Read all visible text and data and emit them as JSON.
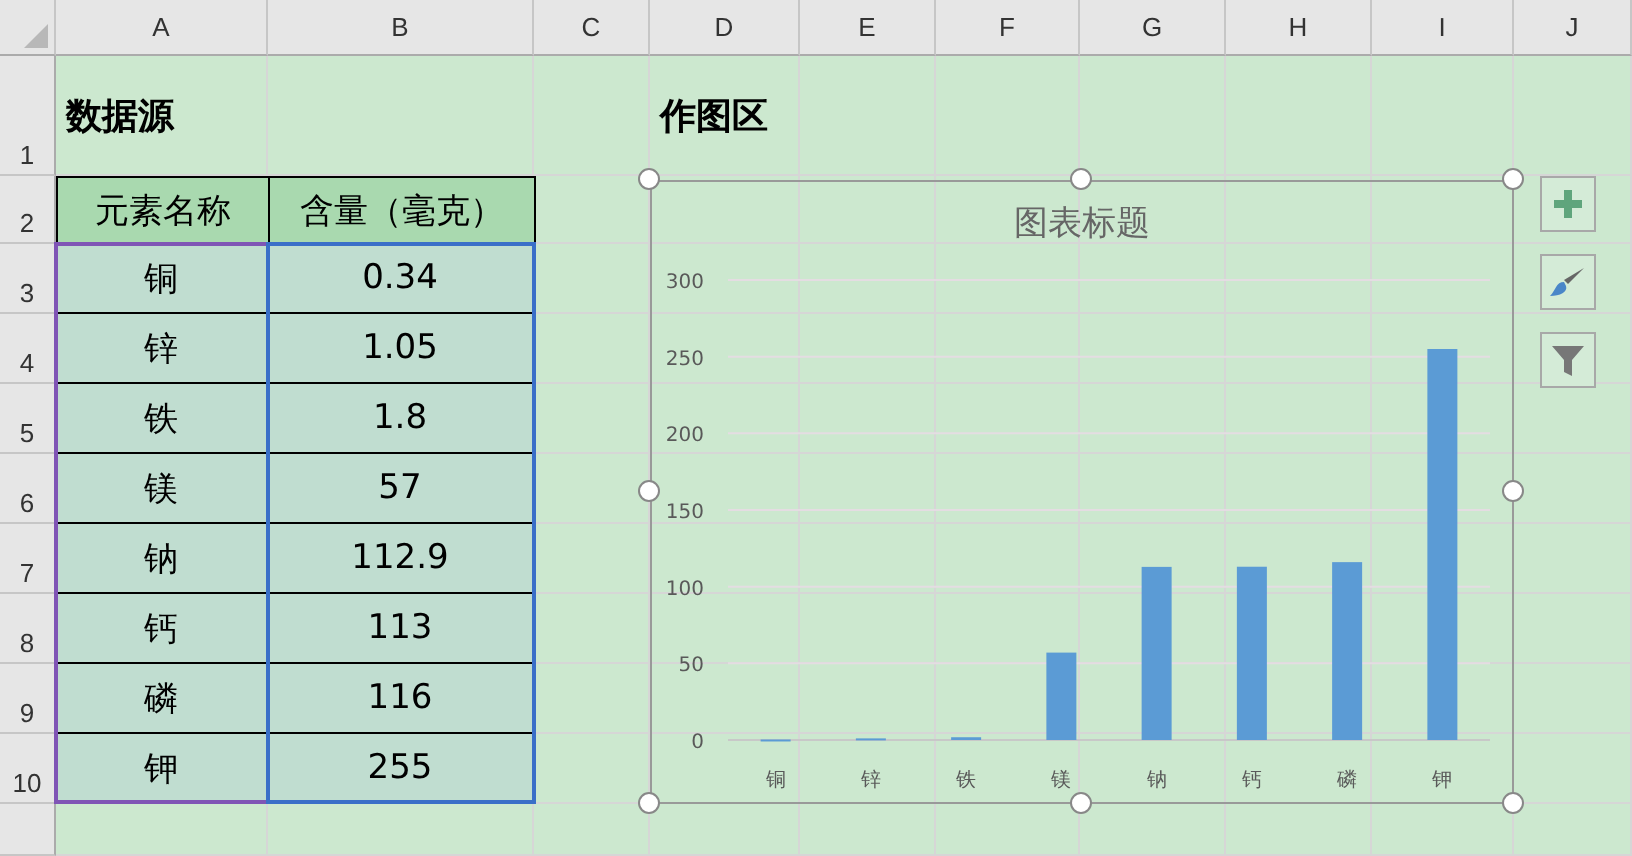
{
  "columns": [
    "A",
    "B",
    "C",
    "D",
    "E",
    "F",
    "G",
    "H",
    "I",
    "J"
  ],
  "row_numbers": [
    "1",
    "2",
    "3",
    "4",
    "5",
    "6",
    "7",
    "8",
    "9",
    "10"
  ],
  "source_title": "数据源",
  "chart_area_title": "作图区",
  "table": {
    "headers": [
      "元素名称",
      "含量（毫克）"
    ],
    "rows": [
      [
        "铜",
        "0.34"
      ],
      [
        "锌",
        "1.05"
      ],
      [
        "铁",
        "1.8"
      ],
      [
        "镁",
        "57"
      ],
      [
        "钠",
        "112.9"
      ],
      [
        "钙",
        "113"
      ],
      [
        "磷",
        "116"
      ],
      [
        "钾",
        "255"
      ]
    ]
  },
  "chart": {
    "chart_data": {
      "type": "bar",
      "title": "图表标题",
      "categories": [
        "铜",
        "锌",
        "铁",
        "镁",
        "钠",
        "钙",
        "磷",
        "钾"
      ],
      "grid": true,
      "series": [
        {
          "color": "#5b9bd5",
          "values": [
            0.34,
            1.05,
            1.8,
            57,
            112.9,
            113,
            116,
            255
          ]
        }
      ],
      "ylim": [
        0,
        300
      ],
      "yticks": [
        0,
        50,
        100,
        150,
        200,
        250,
        300
      ]
    }
  }
}
